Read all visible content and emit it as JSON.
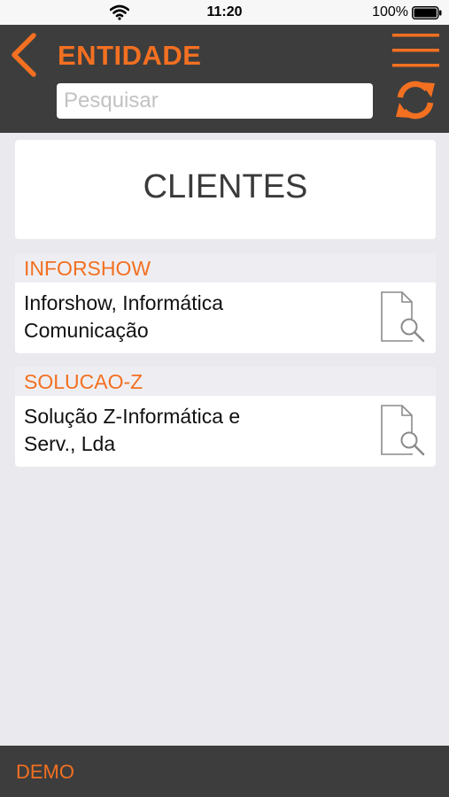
{
  "status_bar": {
    "time": "11:20",
    "battery": "100%"
  },
  "header": {
    "title": "ENTIDADE",
    "search_placeholder": "Pesquisar"
  },
  "section": {
    "title": "CLIENTES"
  },
  "clients": [
    {
      "code": "INFORSHOW",
      "name_line1": "Inforshow, Informática",
      "name_line2": "Comunicação"
    },
    {
      "code": "SOLUCAO-Z",
      "name_line1": "Solução Z-Informática e",
      "name_line2": "Serv., Lda"
    }
  ],
  "footer": {
    "label": "DEMO"
  },
  "colors": {
    "accent": "#f37021",
    "header_bg": "#3d3d3d",
    "page_bg": "#e9e9ee"
  },
  "icons": {
    "back": "chevron-left-icon",
    "menu": "hamburger-menu-icon",
    "refresh": "refresh-icon",
    "client_detail": "document-search-icon"
  }
}
